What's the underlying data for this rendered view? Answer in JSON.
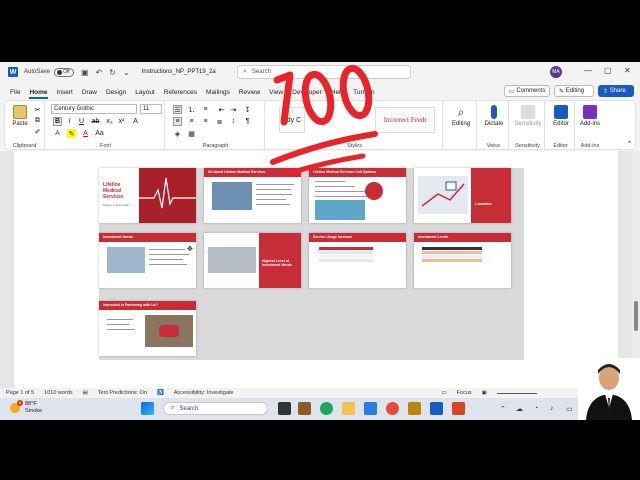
{
  "titlebar": {
    "autosave": "AutoSave",
    "autosave_state": "Off",
    "doc_name": "Instructions_NP_PPT19_2a",
    "search_placeholder": "Search",
    "avatar": "MA"
  },
  "menu": [
    "File",
    "Home",
    "Insert",
    "Draw",
    "Design",
    "Layout",
    "References",
    "Mailings",
    "Review",
    "View",
    "Developer",
    "Help",
    "Turnitin"
  ],
  "menu_buttons": {
    "comments": "Comments",
    "editing": "Editing",
    "share": "Share"
  },
  "ribbon": {
    "paste": "Paste",
    "font_name": "Century Gothic",
    "font_size": "11",
    "style_text": "Incorrect Feedt",
    "normal_text": "ody C",
    "editing": "Editing",
    "dictate": "Dictate",
    "sensitivity": "Sensitivity",
    "editor": "Editor",
    "addins": "Add-ins",
    "groups": {
      "clipboard": "Clipboard",
      "font": "Font",
      "paragraph": "Paragraph",
      "styles": "Styles",
      "voice": "Voice",
      "sensitivity": "Sensitivity",
      "editor": "Editor",
      "addins": "Add-ins"
    }
  },
  "slides": [
    {
      "num": "1",
      "title": "Lifeline Medical Services",
      "subtitle": "Partners in heart health"
    },
    {
      "num": "2",
      "title": "All about Lifeline Medical Services"
    },
    {
      "num": "3",
      "title": "Lifeline Medical Services Call Options"
    },
    {
      "num": "4",
      "title": "Location"
    },
    {
      "num": "5",
      "title": "Investment Needs"
    },
    {
      "num": "6",
      "title": "Highest Level of Investment Needs"
    },
    {
      "num": "7",
      "title": "Service Usage Increase"
    },
    {
      "num": "8",
      "title": "Investment Levels"
    },
    {
      "num": "9",
      "title": "Interested in Partnering with Us?"
    }
  ],
  "status": {
    "page": "Page 1 of 5",
    "words": "1010 words",
    "predictions": "Text Predictions: On",
    "accessibility": "Accessibility: Investigate",
    "focus": "Focus"
  },
  "taskbar": {
    "temp": "88°F",
    "condition": "Smoke",
    "weather_badge": "6",
    "search": "Search"
  },
  "colors": {
    "accent": "#185abd",
    "slide_red": "#c62d36",
    "emoji_red": "#e8242b"
  }
}
